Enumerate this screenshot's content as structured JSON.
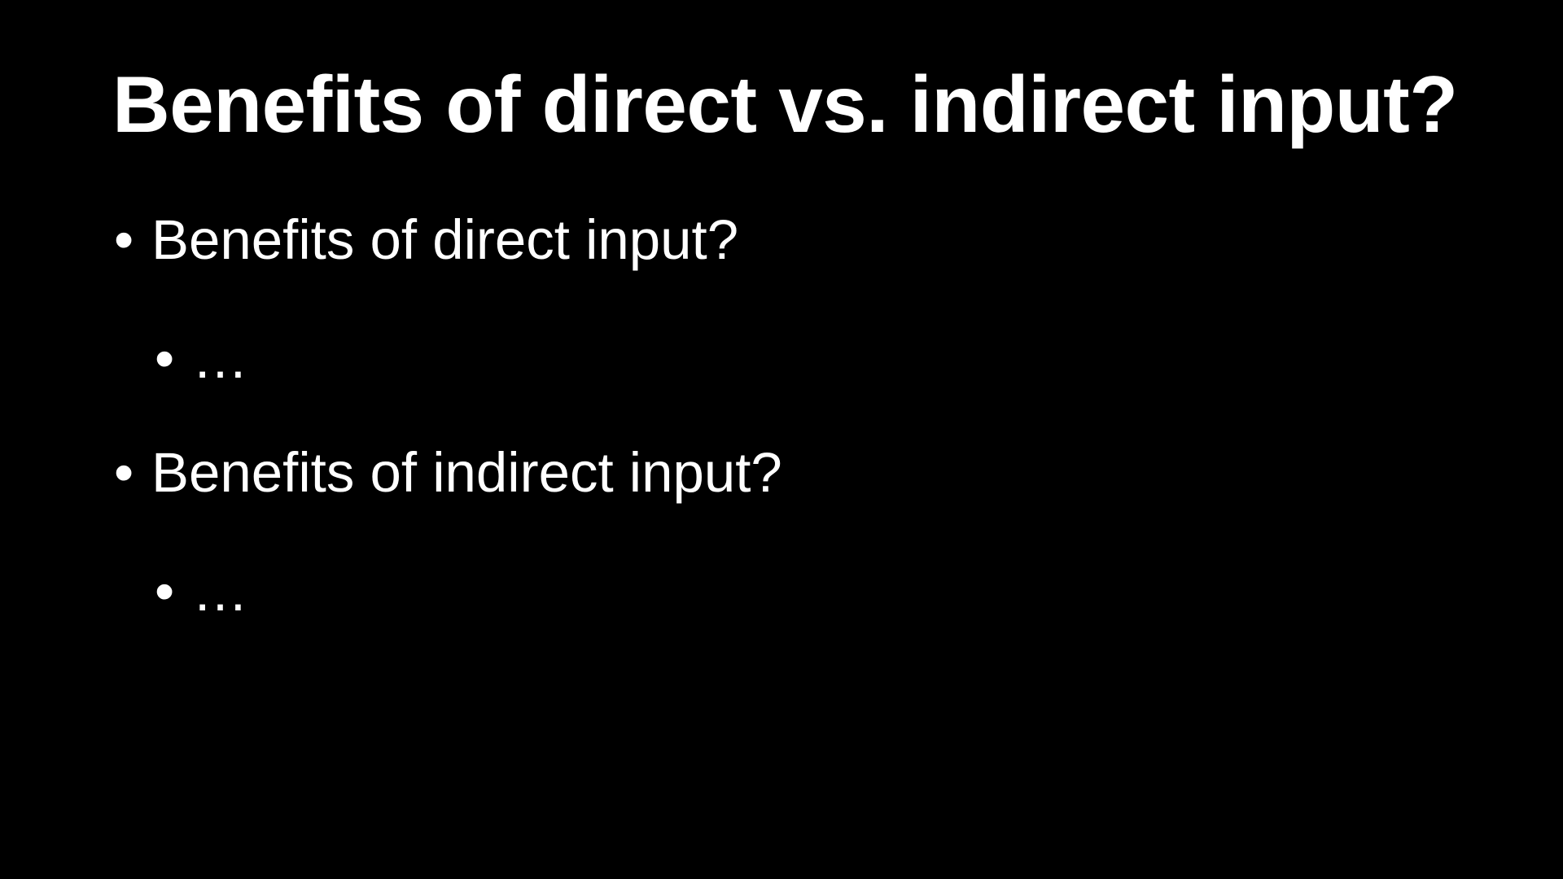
{
  "slide": {
    "title": "Benefits of direct vs. indirect input?",
    "bullet_glyph": "•",
    "bullets": [
      {
        "text": "Benefits of direct input?",
        "level": 1
      },
      {
        "text": "…",
        "level": 2
      },
      {
        "text": "Benefits of indirect input?",
        "level": 1
      },
      {
        "text": "…",
        "level": 2
      }
    ]
  },
  "colors": {
    "background": "#000000",
    "text": "#ffffff"
  }
}
